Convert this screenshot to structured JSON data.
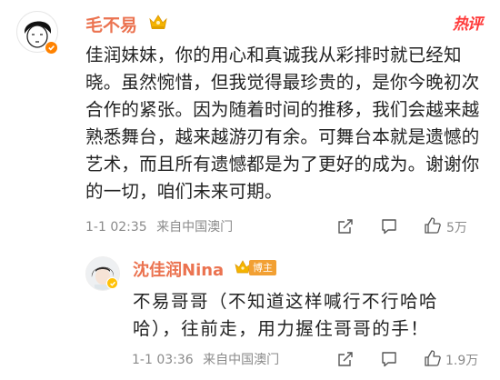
{
  "hot_tag": "热评",
  "main_comment": {
    "username": "毛不易",
    "text": "佳润妹妹，你的用心和真诚我从彩排时就已经知晓。虽然惋惜，但我觉得最珍贵的，是你今晚初次合作的紧张。因为随着时间的推移，我们会越来越熟悉舞台，越来越游刃有余。可舞台本就是遗憾的艺术，而且所有遗憾都是为了更好的成为。谢谢你的一切，咱们未来可期。",
    "timestamp": "1-1 02:35",
    "location": "来自中国澳门",
    "like_count": "5万",
    "colors": {
      "username": "#eb7350",
      "verified": "#ff8200"
    }
  },
  "reply": {
    "username": "沈佳润Nina",
    "tag_label": "博主",
    "text": "不易哥哥（不知道这样喊行不行哈哈哈），往前走，用力握住哥哥的手！",
    "timestamp": "1-1 03:36",
    "location": "来自中国澳门",
    "like_count": "1.9万"
  }
}
